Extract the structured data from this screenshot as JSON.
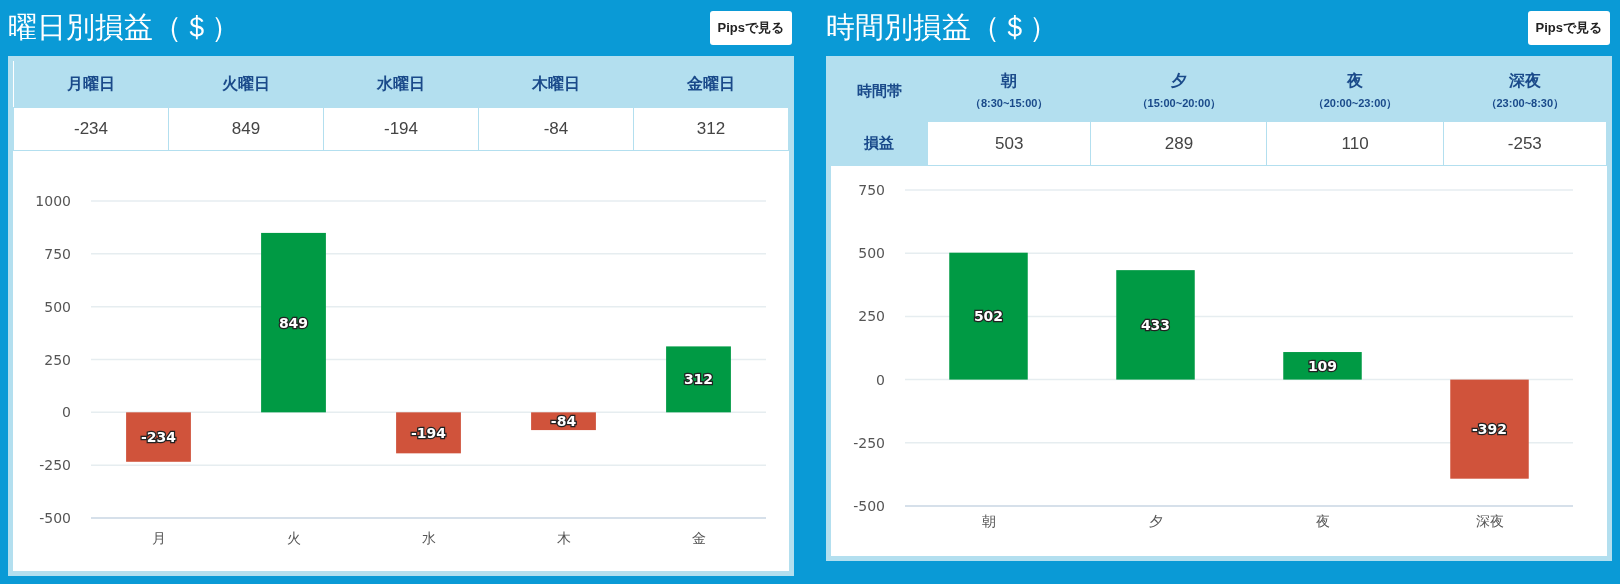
{
  "panels": [
    {
      "title": "曜日別損益（＄）",
      "button": "Pipsで見る",
      "table": {
        "columns": [
          {
            "label": "月曜日"
          },
          {
            "label": "火曜日"
          },
          {
            "label": "水曜日"
          },
          {
            "label": "木曜日"
          },
          {
            "label": "金曜日"
          }
        ],
        "rows": [
          {
            "cells": [
              "-234",
              "849",
              "-194",
              "-84",
              "312"
            ]
          }
        ]
      },
      "chart_data": {
        "type": "bar",
        "categories": [
          "月",
          "火",
          "水",
          "木",
          "金"
        ],
        "series": [
          {
            "color": "#009a44",
            "values": [
              null,
              849,
              null,
              null,
              312
            ]
          },
          {
            "color": "#d0533b",
            "values": [
              -234,
              null,
              -194,
              -84,
              null
            ]
          }
        ],
        "stacked": true,
        "grid": true,
        "ylim": [
          -500,
          1000
        ],
        "yticks": [
          -500,
          -250,
          0,
          250,
          500,
          750,
          1000
        ],
        "value_labels": [
          "-234",
          "849",
          "-194",
          "-84",
          "312"
        ]
      }
    },
    {
      "title": "時間別損益（＄）",
      "button": "Pipsで見る",
      "table": {
        "corner": "時間帯",
        "columns": [
          {
            "label": "朝",
            "sub": "（8:30~15:00）"
          },
          {
            "label": "夕",
            "sub": "（15:00~20:00）"
          },
          {
            "label": "夜",
            "sub": "（20:00~23:00）"
          },
          {
            "label": "深夜",
            "sub": "（23:00~8:30）"
          }
        ],
        "rows": [
          {
            "label": "損益",
            "cells": [
              "503",
              "289",
              "110",
              "-253"
            ]
          }
        ]
      },
      "chart_data": {
        "type": "bar",
        "categories": [
          "朝",
          "夕",
          "夜",
          "深夜"
        ],
        "series": [
          {
            "color": "#009a44",
            "values": [
              502,
              433,
              109,
              null
            ]
          },
          {
            "color": "#d0533b",
            "values": [
              null,
              null,
              null,
              -392
            ]
          }
        ],
        "stacked": true,
        "grid": true,
        "ylim": [
          -500,
          750
        ],
        "yticks": [
          -500,
          -250,
          0,
          250,
          500,
          750
        ],
        "value_labels": [
          "502",
          "433",
          "109",
          "-392"
        ]
      }
    }
  ]
}
